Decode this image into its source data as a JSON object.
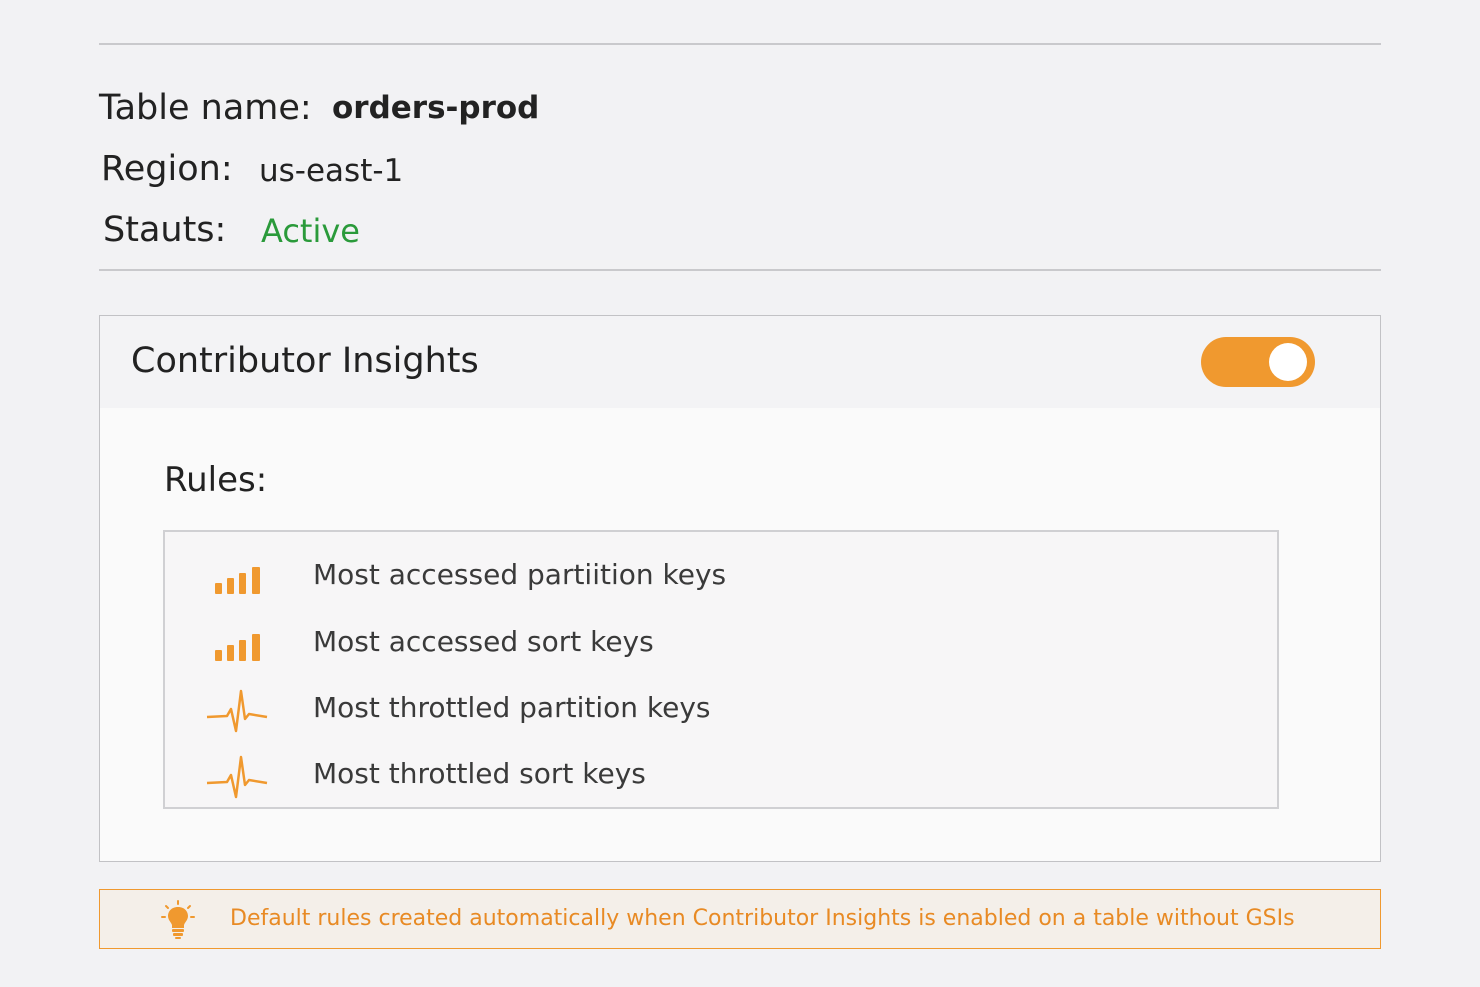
{
  "details": {
    "table_name_label": "Table name:",
    "table_name_value": "orders-prod",
    "region_label": "Region:",
    "region_value": "us-east-1",
    "status_label": "Stauts:",
    "status_value": "Active",
    "status_color": "#2a9a3a"
  },
  "insights": {
    "title": "Contributor Insights",
    "enabled": true,
    "toggle_color": "#f0992f",
    "rules_label": "Rules:",
    "rules": [
      {
        "label": "Most accessed partiition keys",
        "icon": "signal-bars-icon"
      },
      {
        "label": "Most accessed sort keys",
        "icon": "signal-bars-icon"
      },
      {
        "label": "Most throttled partition keys",
        "icon": "pulse-icon"
      },
      {
        "label": "Most throttled sort keys",
        "icon": "pulse-icon"
      }
    ]
  },
  "note": {
    "icon": "lightbulb-icon",
    "text": "Default rules created automatically when Contributor Insights is enabled on a table without GSIs",
    "accent_color": "#f0992f"
  }
}
